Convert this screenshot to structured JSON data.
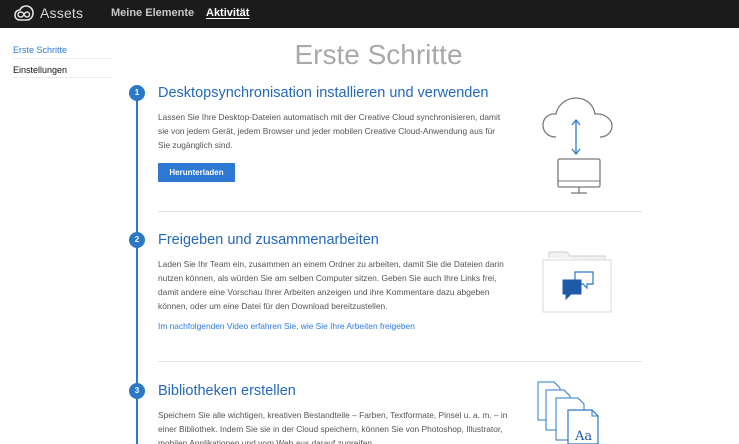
{
  "header": {
    "brand": "Assets",
    "nav": [
      {
        "label": "Meine Elemente",
        "active": false
      },
      {
        "label": "Aktivität",
        "active": true
      }
    ]
  },
  "sidebar": {
    "items": [
      {
        "label": "Erste Schritte",
        "active": true
      },
      {
        "label": "Einstellungen",
        "active": false
      }
    ]
  },
  "main": {
    "title": "Erste Schritte",
    "steps": [
      {
        "number": "1",
        "title": "Desktopsynchronisation installieren und verwenden",
        "description": "Lassen Sie Ihre Desktop-Dateien automatisch mit der Creative Cloud synchronisieren, damit sie von jedem Gerät, jedem Browser und jeder mobilen Creative Cloud-Anwendung aus für Sie zugänglich sind.",
        "button": "Herunterladen"
      },
      {
        "number": "2",
        "title": "Freigeben und zusammenarbeiten",
        "description": "Laden Sie Ihr Team ein, zusammen an einem Ordner zu arbeiten, damit Sie die Dateien darin nutzen können, als würden Sie am selben Computer sitzen. Geben Sie auch Ihre Links frei, damit andere eine Vorschau Ihrer Arbeiten anzeigen und ihre Kommentare dazu abgeben können, oder um eine Datei für den Download bereitzustellen.",
        "link": "Im nachfolgenden Video erfahren Sie, wie Sie Ihre Arbeiten freigeben"
      },
      {
        "number": "3",
        "title": "Bibliotheken erstellen",
        "description": "Speichern Sie alle wichtigen, kreativen Bestandteile – Farben, Textformate, Pinsel u. a. m. – in einer Bibliothek. Indem Sie sie in der Cloud speichern, können Sie von Photoshop, Illustrator, mobilen Applikationen und vom Web aus darauf zugreifen.",
        "illustration_text": "Aa"
      }
    ]
  },
  "colors": {
    "accent": "#2b78c6",
    "topbar": "#1b1b1b",
    "title_gray": "#a9a9a9"
  },
  "icons": [
    "creative-cloud-logo-icon",
    "cloud-sync-icon",
    "shared-folder-comment-icon",
    "library-files-icon"
  ]
}
